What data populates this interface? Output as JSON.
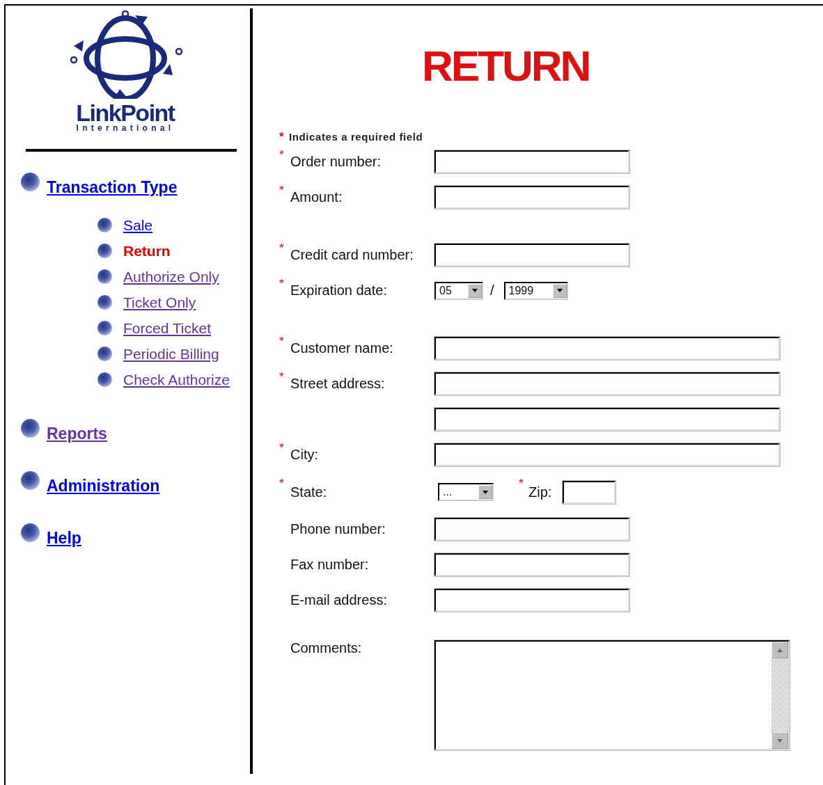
{
  "logo": {
    "name": "LinkPoint",
    "tagline": "International"
  },
  "nav": [
    {
      "label": "Transaction Type",
      "visited": false,
      "selected": false,
      "children": [
        {
          "label": "Sale",
          "visited": false,
          "selected": false
        },
        {
          "label": "Return",
          "visited": false,
          "selected": true
        },
        {
          "label": "Authorize Only",
          "visited": true,
          "selected": false
        },
        {
          "label": "Ticket Only",
          "visited": true,
          "selected": false
        },
        {
          "label": "Forced Ticket",
          "visited": true,
          "selected": false
        },
        {
          "label": "Periodic Billing",
          "visited": true,
          "selected": false
        },
        {
          "label": "Check Authorize",
          "visited": true,
          "selected": false
        }
      ]
    },
    {
      "label": "Reports",
      "visited": true,
      "selected": false
    },
    {
      "label": "Administration",
      "visited": false,
      "selected": false
    },
    {
      "label": "Help",
      "visited": false,
      "selected": false
    }
  ],
  "title": "RETURN",
  "note": {
    "marker": "*",
    "text": "Indicates a required field"
  },
  "groups": [
    [
      {
        "kind": "short",
        "marker": "*",
        "label": "Order number:"
      },
      {
        "kind": "short",
        "marker": "*",
        "label": "Amount:"
      }
    ],
    [
      {
        "kind": "short",
        "marker": "*",
        "label": "Credit card number:"
      },
      {
        "kind": "date",
        "marker": "*",
        "label": "Expiration date:",
        "month": "05",
        "separator": "/",
        "year": "1999"
      }
    ],
    [
      {
        "kind": "long",
        "marker": "*",
        "label": "Customer name:"
      },
      {
        "kind": "long",
        "marker": "*",
        "label": "Street address:"
      },
      {
        "kind": "long"
      },
      {
        "kind": "long",
        "marker": "*",
        "label": "City:"
      },
      {
        "kind": "statezip",
        "marker": "*",
        "label": "State:",
        "state": "...",
        "zip_marker": "*",
        "zip_label": "Zip:"
      },
      {
        "kind": "short",
        "label": "Phone number:"
      },
      {
        "kind": "short",
        "label": "Fax number:"
      },
      {
        "kind": "short",
        "label": "E-mail address:"
      }
    ],
    [
      {
        "kind": "textarea",
        "label": "Comments:"
      }
    ]
  ]
}
